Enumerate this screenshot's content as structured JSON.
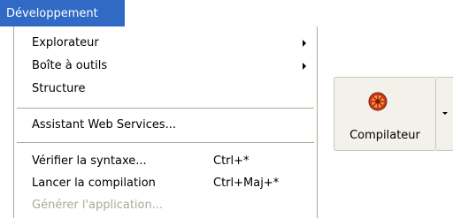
{
  "menubar": {
    "title": "Développement"
  },
  "menu": {
    "items": [
      {
        "label": "Explorateur",
        "has_submenu": true
      },
      {
        "label": "Boîte à outils",
        "has_submenu": true
      },
      {
        "label": "Structure"
      },
      {
        "label": "Assistant Web Services..."
      },
      {
        "label": "Vérifier la syntaxe...",
        "shortcut": "Ctrl+*"
      },
      {
        "label": "Lancer la compilation",
        "shortcut": "Ctrl+Maj+*"
      },
      {
        "label": "Générer l'application...",
        "disabled": true
      }
    ]
  },
  "toolbar": {
    "compile_label": "Compilateur",
    "compile_icon": "compiler-icon"
  },
  "colors": {
    "menu_highlight": "#316ac5",
    "disabled_text": "#aca899",
    "icon_red": "#c8381a",
    "icon_orange": "#f4a13a"
  }
}
